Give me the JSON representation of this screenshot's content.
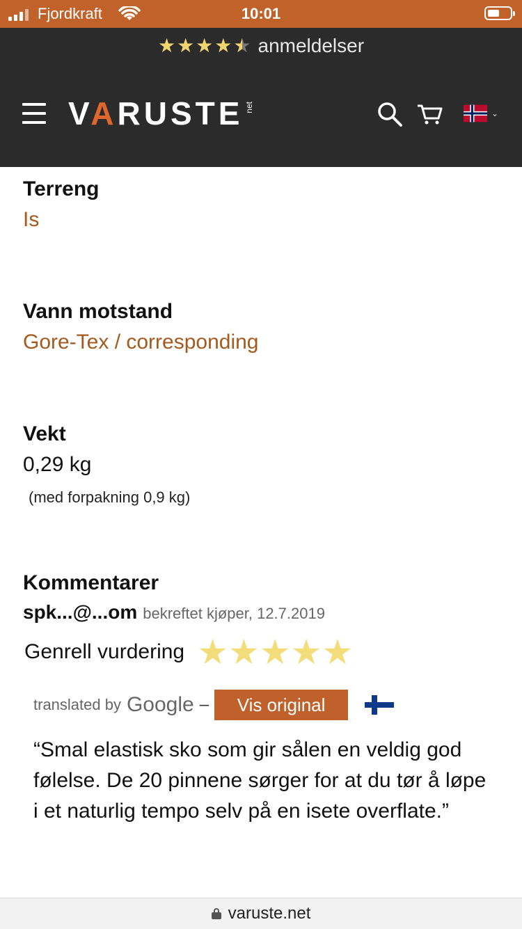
{
  "status": {
    "carrier": "Fjordkraft",
    "time": "10:01"
  },
  "reviews_bar": {
    "rating": 4.5,
    "text": "anmeldelser"
  },
  "header": {
    "logo_main": "VARUSTE",
    "logo_suffix": "net"
  },
  "specs": {
    "terrain": {
      "title": "Terreng",
      "value": "Is"
    },
    "water": {
      "title": "Vann motstand",
      "value": "Gore-Tex / corresponding"
    },
    "weight": {
      "title": "Vekt",
      "value": "0,29 kg",
      "note": "(med forpakning 0,9 kg)"
    }
  },
  "comments": {
    "title": "Kommentarer",
    "reviewer_email": "spk...@...om",
    "reviewer_meta": "bekreftet kjøper, 12.7.2019",
    "overall_label": "Genrell vurdering",
    "overall_rating": 5,
    "translated_by": "translated by",
    "google": "Google",
    "dash": "–",
    "show_original": "Vis original",
    "quote": "“Smal elastisk sko som gir sålen en veldig god følelse. De 20 pinnene sørger for at du tør å løpe i et naturlig tempo selv på en isete overflate.”"
  },
  "urlbar": {
    "url": "varuste.net"
  },
  "colors": {
    "accent": "#c0622a",
    "dark": "#2b2b2b",
    "link": "#a45a1e",
    "star": "#f1d46e"
  }
}
